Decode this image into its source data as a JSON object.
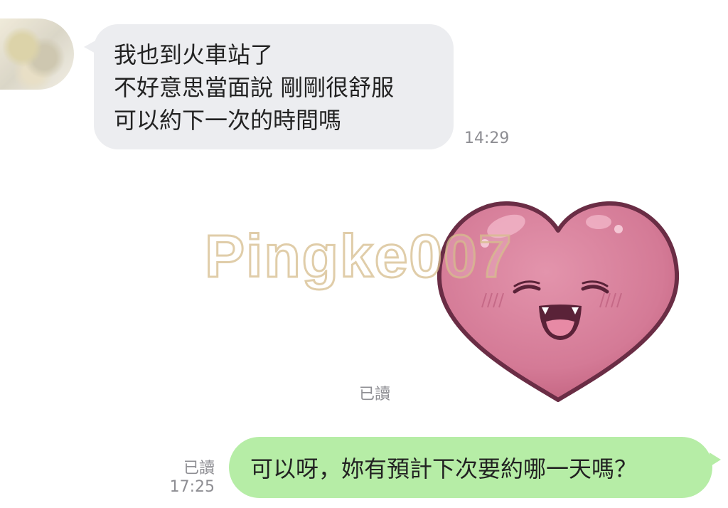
{
  "incoming": {
    "lines": [
      "我也到火車站了",
      "不好意思當面說 剛剛很舒服",
      "可以約下一次的時間嗎"
    ],
    "time": "14:29"
  },
  "sticker": {
    "name": "heart-smile-sticker",
    "read_status": "已讀"
  },
  "watermark": "Pingke007",
  "outgoing": {
    "text": "可以呀，妳有預計下次要約哪一天嗎？",
    "read_status": "已讀",
    "time": "17:25"
  },
  "colors": {
    "incoming_bubble": "#ecedf0",
    "outgoing_bubble": "#b6eda6",
    "heart": "#d47a96",
    "meta_text": "#8e8e93"
  }
}
